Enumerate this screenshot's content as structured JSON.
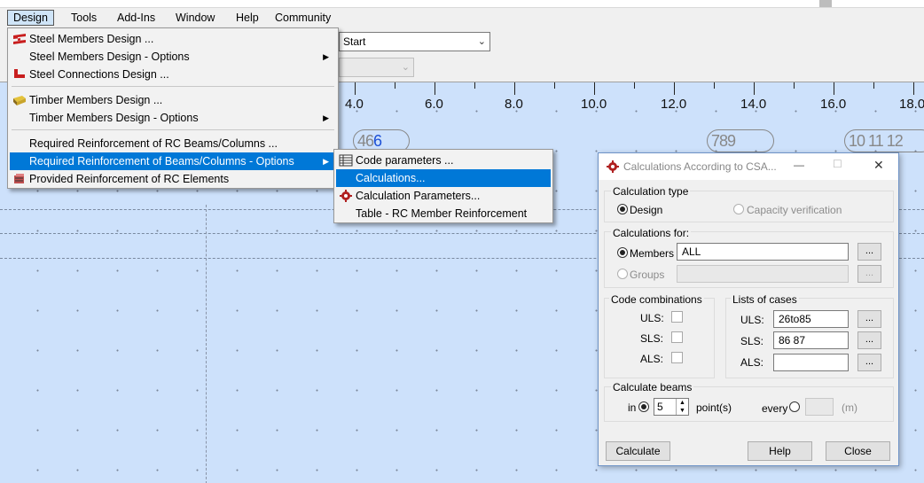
{
  "menubar": {
    "items": [
      "Design",
      "Tools",
      "Add-Ins",
      "Window",
      "Help",
      "Community"
    ]
  },
  "toolbar": {
    "combo_value": "Start"
  },
  "ruler": {
    "labels": [
      "4.0",
      "6.0",
      "8.0",
      "10.0",
      "12.0",
      "14.0",
      "16.0",
      "18.0"
    ]
  },
  "nodes": {
    "a_gray": "4",
    "a_blue": "6",
    "a_gray2": "6",
    "b": "789",
    "c": "10 11 12"
  },
  "design_menu": {
    "items": [
      "Steel Members Design ...",
      "Steel Members Design - Options",
      "Steel Connections Design ...",
      "Timber Members Design ...",
      "Timber Members Design - Options",
      "Required Reinforcement of RC Beams/Columns ...",
      "Required Reinforcement of Beams/Columns - Options",
      "Provided Reinforcement of RC Elements"
    ]
  },
  "options_submenu": {
    "items": [
      "Code parameters ...",
      "Calculations...",
      "Calculation Parameters...",
      "Table - RC Member Reinforcement"
    ]
  },
  "dialog": {
    "title": "Calculations According to CSA...",
    "calc_type": {
      "label": "Calculation type",
      "design": "Design",
      "capacity": "Capacity verification"
    },
    "calc_for": {
      "label": "Calculations for:",
      "members": "Members",
      "members_value": "ALL",
      "groups": "Groups"
    },
    "code_comb": {
      "label": "Code combinations",
      "uls": "ULS:",
      "sls": "SLS:",
      "als": "ALS:"
    },
    "lists": {
      "label": "Lists of cases",
      "uls": "ULS:",
      "sls": "SLS:",
      "als": "ALS:",
      "uls_value": "26to85",
      "sls_value": "86 87",
      "als_value": ""
    },
    "beams": {
      "label": "Calculate beams",
      "in": "in",
      "points_value": "5",
      "points": "point(s)",
      "every": "every",
      "unit": "(m)"
    },
    "dots": "...",
    "buttons": {
      "calculate": "Calculate",
      "help": "Help",
      "close": "Close"
    },
    "controls": {
      "minimize": "—",
      "maximize": "☐",
      "close": "✕"
    }
  },
  "colors": {
    "highlight": "#0078d7",
    "canvas": "#cde1fb"
  }
}
